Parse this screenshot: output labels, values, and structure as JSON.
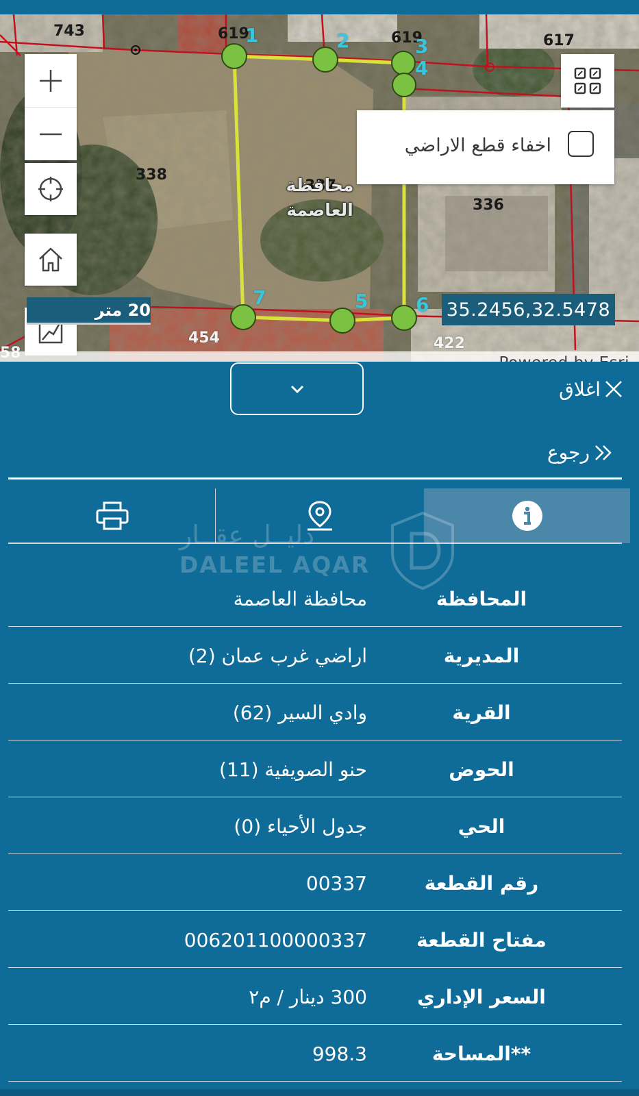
{
  "map": {
    "parcel_labels": [
      "743",
      "619",
      "619",
      "617",
      "338",
      "337",
      "336",
      "454",
      "422",
      "58"
    ],
    "vertex_labels": [
      "1",
      "2",
      "3",
      "4",
      "5",
      "6",
      "7"
    ],
    "governorate_label": "محافظة العاصمة",
    "scale_text": "20 متر",
    "coordinates": "35.2456,32.5478",
    "attribution": "Powered by Esri",
    "hide_parcels_label": "اخفاء قطع الاراضي",
    "hide_parcels_checked": false,
    "colors": {
      "parcel_boundary": "#c0121e",
      "selection": "#d9e23b",
      "vertex": "#7cc242",
      "vertex_label": "#39c6dd"
    },
    "icons": [
      "plus-icon",
      "minus-icon",
      "locate-icon",
      "home-icon",
      "measure-icon",
      "qr-code-icon"
    ]
  },
  "panel": {
    "close_label": "اغلاق",
    "back_label": "رجوع",
    "tabs": [
      {
        "name": "info",
        "icon": "info-icon",
        "active": true
      },
      {
        "name": "location",
        "icon": "location-pin-icon",
        "active": false
      },
      {
        "name": "print",
        "icon": "printer-icon",
        "active": false
      }
    ],
    "watermark": {
      "ar": "دليــل عقــار",
      "en": "DALEEL AQAR"
    },
    "rows": [
      {
        "key": "المحافظة",
        "value": "محافظة العاصمة"
      },
      {
        "key": "المديرية",
        "value": "اراضي غرب عمان (2)"
      },
      {
        "key": "القرية",
        "value": "وادي السير (62)"
      },
      {
        "key": "الحوض",
        "value": "حنو الصويفية (11)"
      },
      {
        "key": "الحي",
        "value": "جدول الأحياء (0)"
      },
      {
        "key": "رقم القطعة",
        "value": "00337"
      },
      {
        "key": "مفتاح القطعة",
        "value": "006201100000337"
      },
      {
        "key": "السعر الإداري",
        "value": "300 دينار / م٢"
      },
      {
        "key": "**المساحة",
        "value": "998.3"
      }
    ],
    "colors": {
      "background": "#0f6b97",
      "active_tab": "#4a87a8",
      "text": "#ffffff"
    }
  }
}
